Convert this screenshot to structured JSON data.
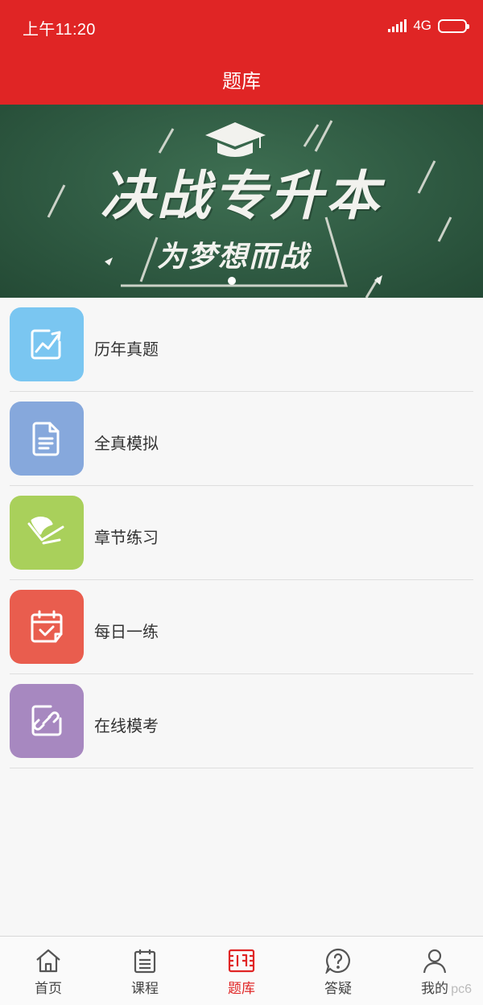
{
  "status": {
    "time": "上午11:20",
    "network": "4G"
  },
  "header": {
    "title": "题库"
  },
  "banner": {
    "headline": "决战专升本",
    "slogan": "为梦想而战"
  },
  "menu": [
    {
      "label": "历年真题",
      "icon": "trend-chart-icon",
      "color": "#7ac6f1"
    },
    {
      "label": "全真模拟",
      "icon": "document-icon",
      "color": "#86a8dc"
    },
    {
      "label": "章节练习",
      "icon": "pen-feather-icon",
      "color": "#a9d05b"
    },
    {
      "label": "每日一练",
      "icon": "calendar-check-icon",
      "color": "#e95d4e"
    },
    {
      "label": "在线模考",
      "icon": "edit-link-icon",
      "color": "#a788c0"
    }
  ],
  "tabs": [
    {
      "label": "首页",
      "icon": "home-icon"
    },
    {
      "label": "课程",
      "icon": "course-list-icon"
    },
    {
      "label": "题库",
      "icon": "question-bank-icon",
      "active": true
    },
    {
      "label": "答疑",
      "icon": "help-icon"
    },
    {
      "label": "我的",
      "icon": "profile-icon"
    }
  ],
  "watermark": "pc6"
}
